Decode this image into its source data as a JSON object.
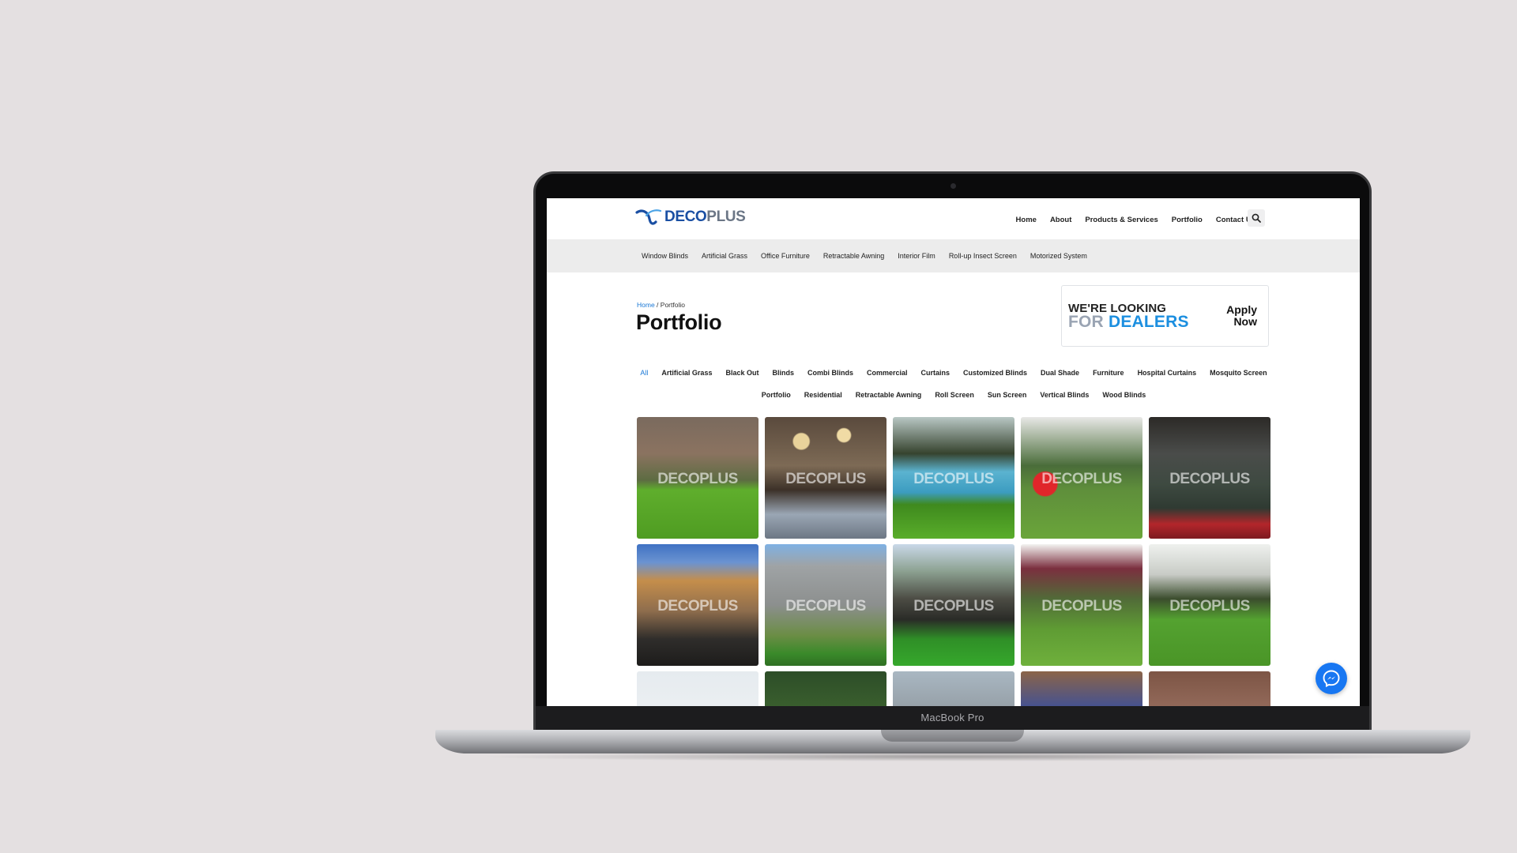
{
  "device": {
    "label": "MacBook Pro"
  },
  "header": {
    "logo": {
      "part1": "DECO",
      "part2": "PLUS"
    },
    "nav": [
      "Home",
      "About",
      "Products & Services",
      "Portfolio",
      "Contact Us"
    ]
  },
  "subnav": [
    "Window Blinds",
    "Artificial Grass",
    "Office Furniture",
    "Retractable Awning",
    "Interior Film",
    "Roll-up Insect Screen",
    "Motorized System"
  ],
  "breadcrumb": {
    "home": "Home",
    "sep": " / ",
    "current": "Portfolio"
  },
  "page_title": "Portfolio",
  "dealer_banner": {
    "line1": "WE'RE LOOKING",
    "line2a": "FOR ",
    "line2b": "DEALERS",
    "apply1": "Apply",
    "apply2": "Now"
  },
  "filters": {
    "row1": [
      "All",
      "Artificial Grass",
      "Black Out",
      "Blinds",
      "Combi Blinds",
      "Commercial",
      "Curtains",
      "Customized Blinds",
      "Dual Shade",
      "Furniture",
      "Hospital Curtains",
      "Mosquito Screen"
    ],
    "row2": [
      "Portfolio",
      "Residential",
      "Retractable Awning",
      "Roll Screen",
      "Sun Screen",
      "Vertical Blinds",
      "Wood Blinds"
    ],
    "active": "All"
  },
  "gallery": {
    "watermark": "DECOPLUS",
    "tiles": 15
  },
  "colors": {
    "brand_blue": "#1a4fa3",
    "accent_blue": "#1c8fe0",
    "messenger": "#1877f2"
  }
}
